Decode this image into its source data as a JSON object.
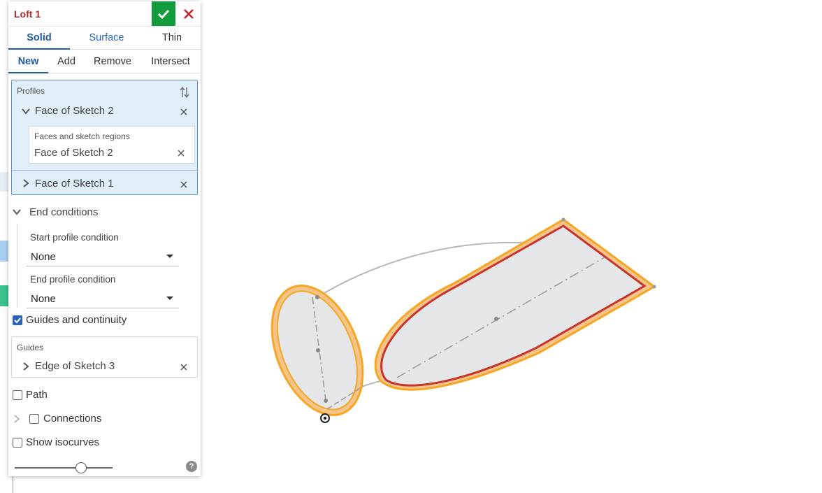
{
  "feature": {
    "title": "Loft 1",
    "accept_icon": "check-icon",
    "cancel_icon": "close-icon"
  },
  "body_type_tabs": [
    {
      "label": "Solid",
      "active": true
    },
    {
      "label": "Surface",
      "active": false
    },
    {
      "label": "Thin",
      "active": false
    }
  ],
  "operation_tabs": [
    {
      "label": "New",
      "active": true
    },
    {
      "label": "Add",
      "active": false
    },
    {
      "label": "Remove",
      "active": false
    },
    {
      "label": "Intersect",
      "active": false
    }
  ],
  "profiles": {
    "label": "Profiles",
    "reorder_icon": "sort-arrows-icon",
    "items": [
      {
        "name": "Face of Sketch 2",
        "expanded": true,
        "sub_label": "Faces and sketch regions",
        "sub_value": "Face of Sketch 2"
      },
      {
        "name": "Face of Sketch 1",
        "expanded": false
      }
    ]
  },
  "end_conditions": {
    "label": "End conditions",
    "start_label": "Start profile condition",
    "start_value": "None",
    "end_label": "End profile condition",
    "end_value": "None"
  },
  "guides_continuity": {
    "label": "Guides and continuity",
    "checked": true,
    "guides_label": "Guides",
    "guide_item": "Edge of Sketch 3"
  },
  "options": {
    "path_label": "Path",
    "path_checked": false,
    "connections_label": "Connections",
    "connections_checked": false,
    "isocurves_label": "Show isocurves",
    "isocurves_checked": false,
    "isocurve_density": 0.68,
    "help_glyph": "?"
  },
  "colors": {
    "title_red": "#b3262b",
    "accent_blue": "#1f5aa6",
    "accept_green": "#139c3d",
    "highlight_orange": "#f5a623",
    "edge_red": "#c8342c",
    "face_gray": "#e4e6e8"
  }
}
